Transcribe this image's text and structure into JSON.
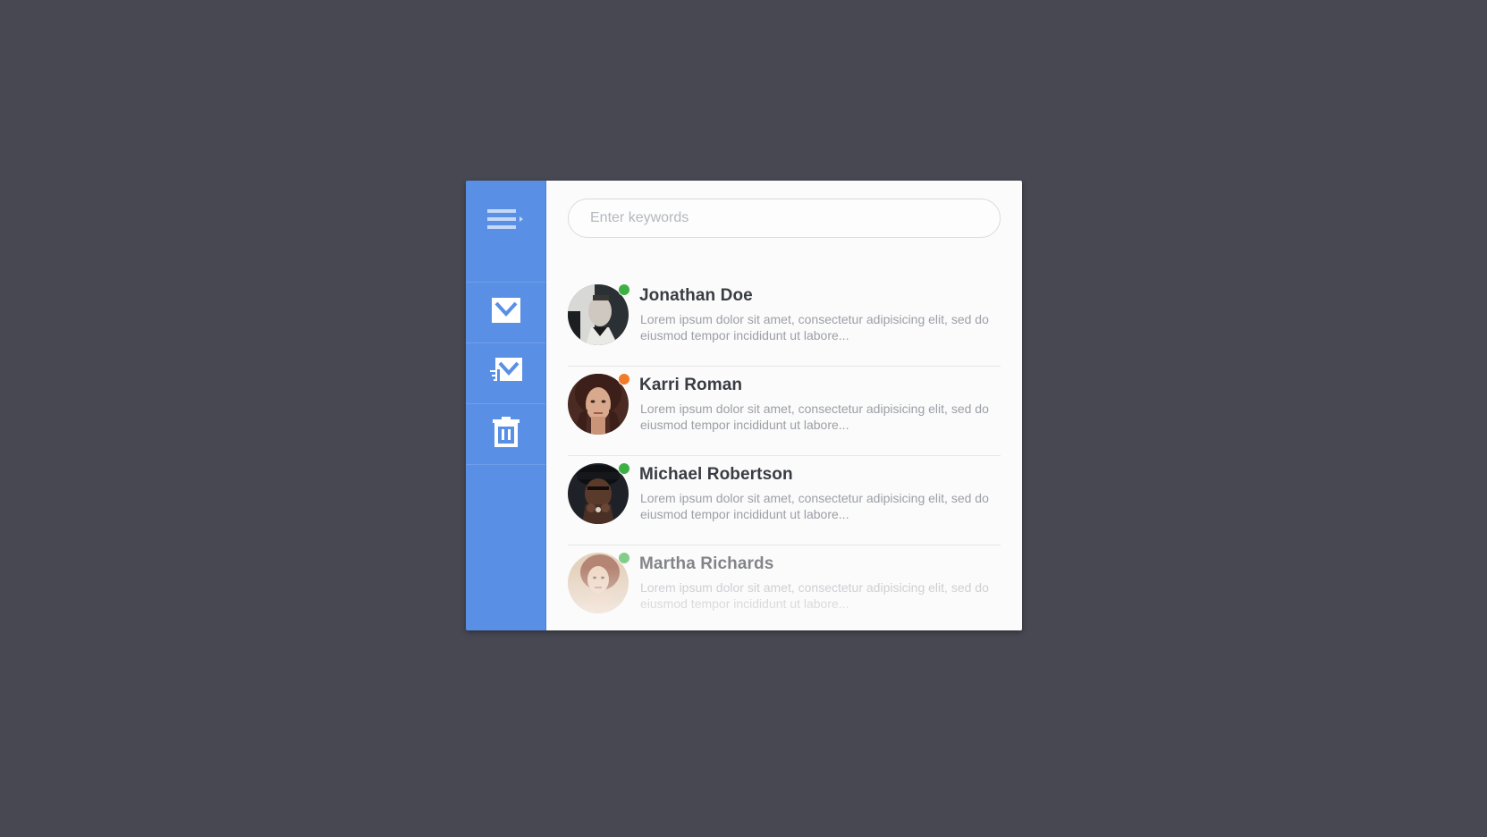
{
  "sidebar": {
    "menu_icon": "menu-icon",
    "items": [
      {
        "icon": "inbox-mail-icon"
      },
      {
        "icon": "sent-mail-icon"
      },
      {
        "icon": "trash-icon"
      }
    ],
    "color": "#5a8fe6"
  },
  "search": {
    "placeholder": "Enter keywords",
    "value": ""
  },
  "contacts": [
    {
      "name": "Jonathan Doe",
      "snippet": "Lorem ipsum dolor sit amet, consectetur adipisicing elit, sed do eiusmod tempor incididunt ut labore...",
      "status_color": "#3cb044"
    },
    {
      "name": "Karri Roman",
      "snippet": "Lorem ipsum dolor sit amet, consectetur adipisicing elit, sed do eiusmod tempor incididunt ut labore...",
      "status_color": "#f07c2a"
    },
    {
      "name": "Michael Robertson",
      "snippet": "Lorem ipsum dolor sit amet, consectetur adipisicing elit, sed do eiusmod tempor incididunt ut labore...",
      "status_color": "#3cb044"
    },
    {
      "name": "Martha Richards",
      "snippet": "Lorem ipsum dolor sit amet, consectetur adipisicing elit, sed do eiusmod tempor incididunt ut labore...",
      "status_color": "#3cb044"
    }
  ]
}
